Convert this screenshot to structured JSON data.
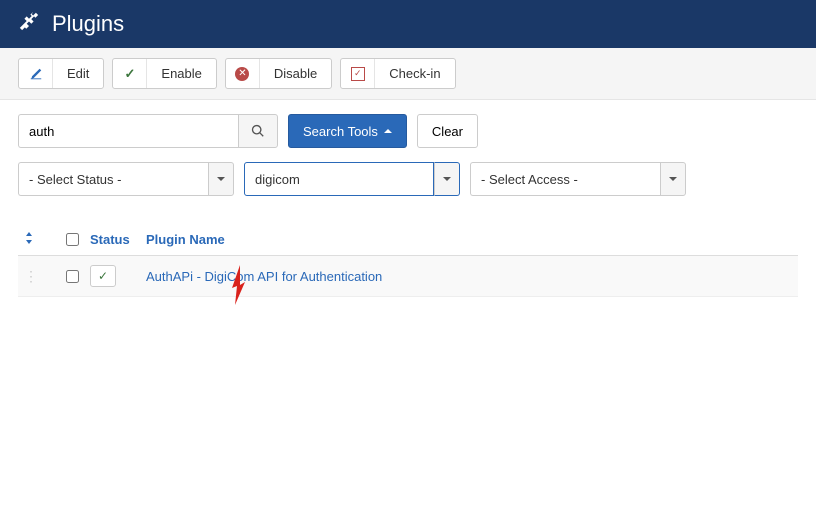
{
  "header": {
    "title": "Plugins"
  },
  "toolbar": {
    "edit": "Edit",
    "enable": "Enable",
    "disable": "Disable",
    "checkin": "Check-in"
  },
  "search": {
    "value": "auth",
    "tools_label": "Search Tools",
    "clear_label": "Clear"
  },
  "filters": {
    "status_placeholder": "- Select Status -",
    "folder_value": "digicom",
    "access_placeholder": "- Select Access -"
  },
  "columns": {
    "status": "Status",
    "name": "Plugin Name"
  },
  "rows": [
    {
      "name": "AuthAPi - DigiCom API for Authentication",
      "enabled": true
    }
  ]
}
